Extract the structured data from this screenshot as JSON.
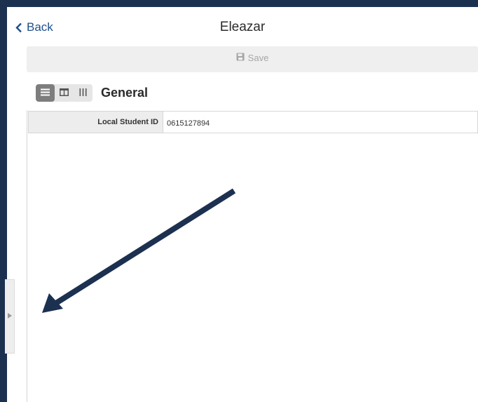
{
  "header": {
    "back_label": "Back",
    "title": "Eleazar"
  },
  "toolbar": {
    "save_label": "Save",
    "save_enabled": false
  },
  "layout_toggle": {
    "options": [
      "single-column-icon",
      "two-column-icon",
      "three-column-icon"
    ],
    "selected": "single-column-icon"
  },
  "section": {
    "title": "General",
    "fields": [
      {
        "label": "Local Student ID",
        "value": "0615127894"
      }
    ]
  },
  "colors": {
    "frame": "#1c3050",
    "link": "#1f4f8a",
    "arrow": "#1c3050"
  }
}
